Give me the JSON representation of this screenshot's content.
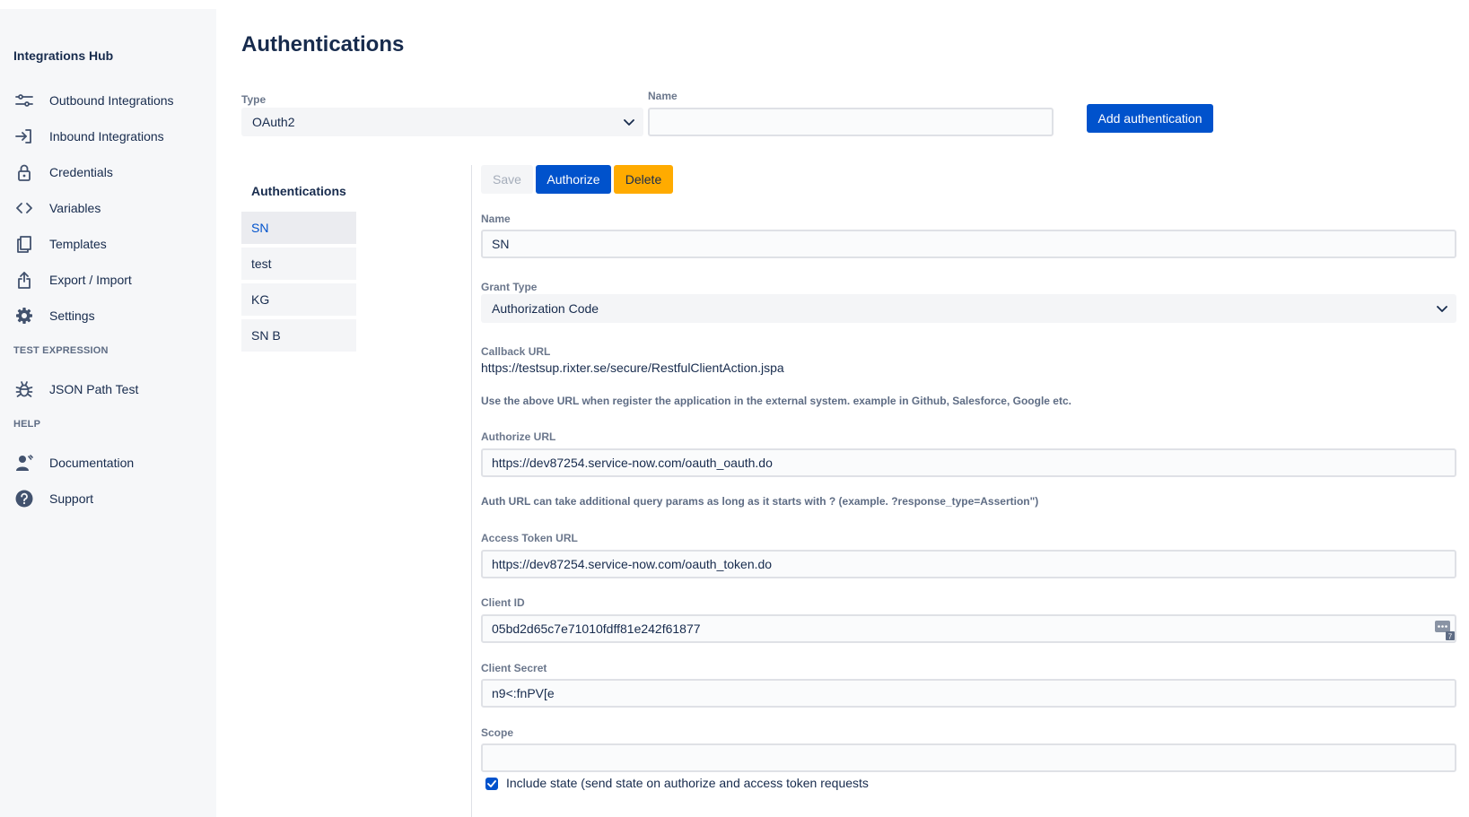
{
  "sidebar": {
    "title": "Integrations Hub",
    "items": [
      {
        "label": "Outbound Integrations",
        "icon": "sliders-icon"
      },
      {
        "label": "Inbound Integrations",
        "icon": "sign-in-icon"
      },
      {
        "label": "Credentials",
        "icon": "lock-icon"
      },
      {
        "label": "Variables",
        "icon": "code-icon"
      },
      {
        "label": "Templates",
        "icon": "copy-icon"
      },
      {
        "label": "Export / Import",
        "icon": "export-icon"
      },
      {
        "label": "Settings",
        "icon": "gear-icon"
      }
    ],
    "test_expression_heading": "TEST EXPRESSION",
    "test_items": [
      {
        "label": "JSON Path Test",
        "icon": "bug-icon"
      }
    ],
    "help_heading": "HELP",
    "help_items": [
      {
        "label": "Documentation",
        "icon": "person-icon"
      },
      {
        "label": "Support",
        "icon": "question-icon"
      }
    ]
  },
  "page": {
    "title": "Authentications"
  },
  "top_form": {
    "type_label": "Type",
    "type_value": "OAuth2",
    "name_label": "Name",
    "name_value": "",
    "add_button": "Add authentication"
  },
  "auth_list": {
    "title": "Authentications",
    "items": [
      "SN",
      "test",
      "KG",
      "SN B"
    ],
    "selected": "SN"
  },
  "toolbar": {
    "save": "Save",
    "authorize": "Authorize",
    "delete": "Delete"
  },
  "detail": {
    "name_label": "Name",
    "name_value": "SN",
    "grant_type_label": "Grant Type",
    "grant_type_value": "Authorization Code",
    "callback_label": "Callback URL",
    "callback_value": "https://testsup.rixter.se/secure/RestfulClientAction.jspa",
    "callback_help": "Use the above URL when register the application in the external system. example in Github, Salesforce, Google etc.",
    "authorize_url_label": "Authorize URL",
    "authorize_url_value": "https://dev87254.service-now.com/oauth_oauth.do",
    "authorize_url_help": "Auth URL can take additional query params as long as it starts with ? (example. ?response_type=Assertion\")",
    "access_token_label": "Access Token URL",
    "access_token_value": "https://dev87254.service-now.com/oauth_token.do",
    "client_id_label": "Client ID",
    "client_id_value": "05bd2d65c7e71010fdff81e242f61877",
    "client_secret_label": "Client Secret",
    "client_secret_value": "n9<:fnPV[e",
    "scope_label": "Scope",
    "scope_value": "",
    "include_state_label": "Include state (send state on authorize and access token requests",
    "include_state_checked": true
  },
  "colors": {
    "primary": "#0052cc",
    "warning": "#ffab00",
    "sidebar_bg": "#f6f7f9"
  }
}
